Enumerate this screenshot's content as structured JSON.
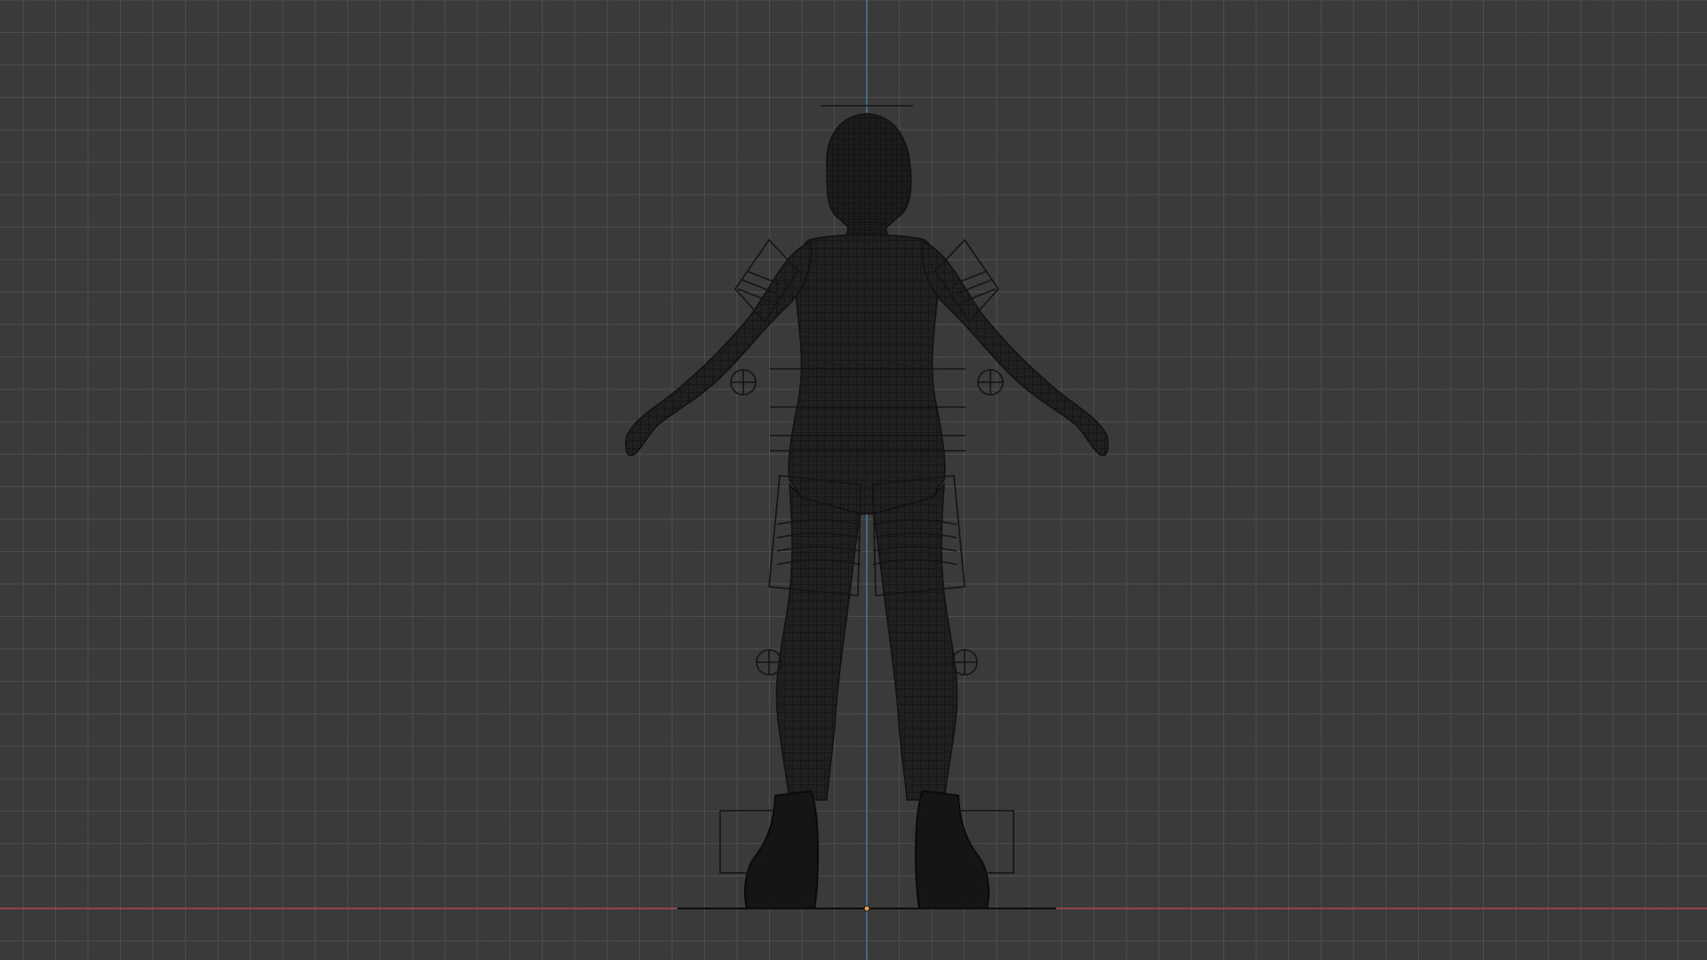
{
  "viewport": {
    "view": "front-orthographic",
    "shading": "wireframe",
    "overlays": {
      "grid": true,
      "x_axis_line": true,
      "z_axis_line": true
    },
    "colors": {
      "background": "#3a3a3a",
      "grid_minor": "#444444",
      "grid_major": "#4d4d4d",
      "x_axis": "#b0444f",
      "z_axis": "#3f7fb0",
      "mesh_fill": "#1b1b1b",
      "mesh_wire": "#121212",
      "armature_wire": "#111111",
      "origin_dot": "#e0a040"
    },
    "scene_objects": [
      {
        "name": "character-mesh",
        "type": "mesh"
      },
      {
        "name": "armature-rig",
        "type": "armature"
      }
    ]
  }
}
